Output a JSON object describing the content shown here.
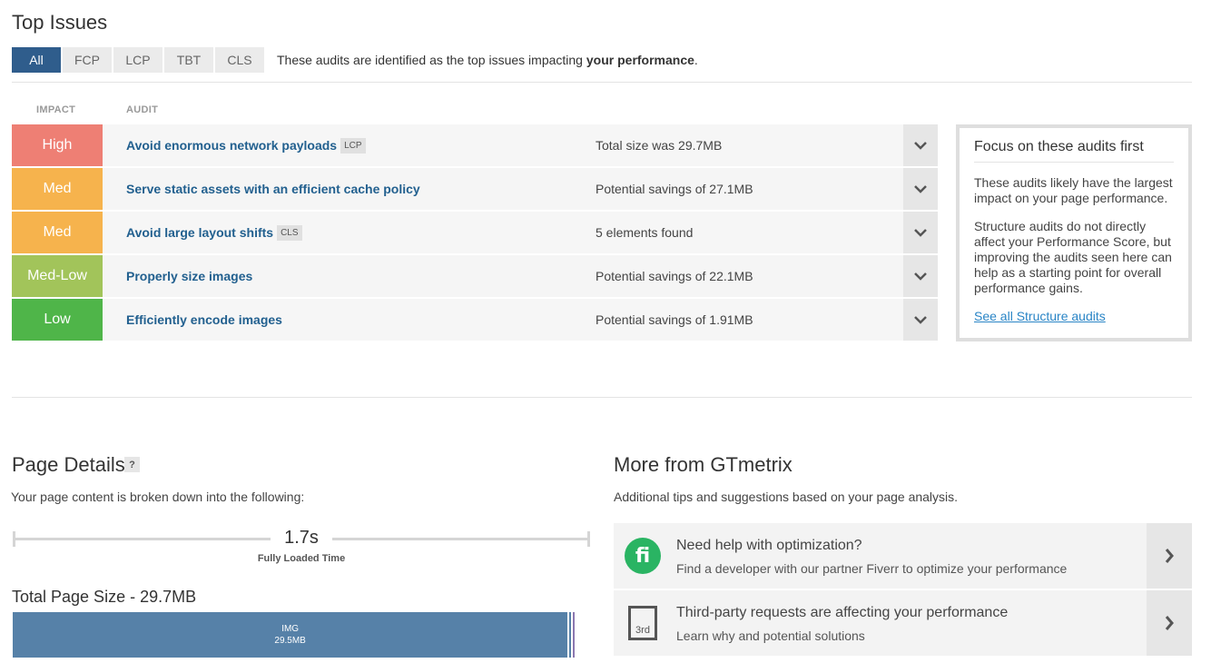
{
  "top_issues": {
    "title": "Top Issues",
    "filters": [
      "All",
      "FCP",
      "LCP",
      "TBT",
      "CLS"
    ],
    "active_filter": "All",
    "description_prefix": "These audits are identified as the top issues impacting ",
    "description_bold": "your performance",
    "description_suffix": ".",
    "col_impact": "IMPACT",
    "col_audit": "AUDIT",
    "audits": [
      {
        "impact": "High",
        "color": "#ee7f74",
        "name": "Avoid enormous network payloads",
        "tag": "LCP",
        "result": "Total size was 29.7MB"
      },
      {
        "impact": "Med",
        "color": "#f6b34d",
        "name": "Serve static assets with an efficient cache policy",
        "tag": "",
        "result": "Potential savings of 27.1MB"
      },
      {
        "impact": "Med",
        "color": "#f6b34d",
        "name": "Avoid large layout shifts",
        "tag": "CLS",
        "result": "5 elements found"
      },
      {
        "impact": "Med-Low",
        "color": "#a2c45a",
        "name": "Properly size images",
        "tag": "",
        "result": "Potential savings of 22.1MB"
      },
      {
        "impact": "Low",
        "color": "#4fb549",
        "name": "Efficiently encode images",
        "tag": "",
        "result": "Potential savings of 1.91MB"
      }
    ]
  },
  "focus": {
    "title": "Focus on these audits first",
    "p1": "These audits likely have the largest impact on your page performance.",
    "p2": "Structure audits do not directly affect your Performance Score, but improving the audits seen here can help as a starting point for overall performance gains.",
    "link": "See all Structure audits"
  },
  "page_details": {
    "title": "Page Details",
    "help": "?",
    "subtitle": "Your page content is broken down into the following:",
    "loaded_time": "1.7s",
    "loaded_label": "Fully Loaded Time",
    "size_title": "Total Page Size - 29.7MB",
    "img_label": "IMG",
    "img_size": "29.5MB",
    "img_fraction": 0.98
  },
  "more": {
    "title": "More from GTmetrix",
    "subtitle": "Additional tips and suggestions based on your page analysis.",
    "promos": [
      {
        "icon": "fiverr-icon",
        "glyph": "fi",
        "heading": "Need help with optimization?",
        "desc": "Find a developer with our partner Fiverr to optimize your performance"
      },
      {
        "icon": "third-party-icon",
        "glyph": "3rd",
        "heading": "Third-party requests are affecting your performance",
        "desc": "Learn why and potential solutions"
      }
    ]
  }
}
